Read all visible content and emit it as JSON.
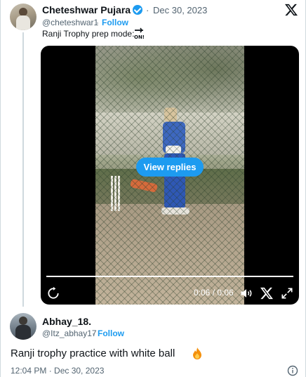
{
  "tweet": {
    "author_name": "Cheteshwar Pujara",
    "separator": "·",
    "date": "Dec 30, 2023",
    "handle": "@cheteshwar1",
    "follow_label": "Follow",
    "text": "Ranji Trophy prep mode:",
    "emoji": "on-arrow-icon"
  },
  "video": {
    "view_replies_label": "View replies",
    "time_current": "0:06",
    "time_total": "0:06",
    "time_separator": " / ",
    "progress": 1.0
  },
  "reply": {
    "author_name": "Abhay_18.",
    "handle": "@Itz_abhay17",
    "separator": "·",
    "follow_label": "Follow",
    "text": "Ranji trophy practice with white ball",
    "emoji": "fire-icon",
    "timestamp": "12:04 PM · Dec 30, 2023"
  },
  "colors": {
    "accent": "#1d9bf0",
    "muted": "#536471",
    "text": "#0f1419",
    "border": "#cfd9de"
  }
}
